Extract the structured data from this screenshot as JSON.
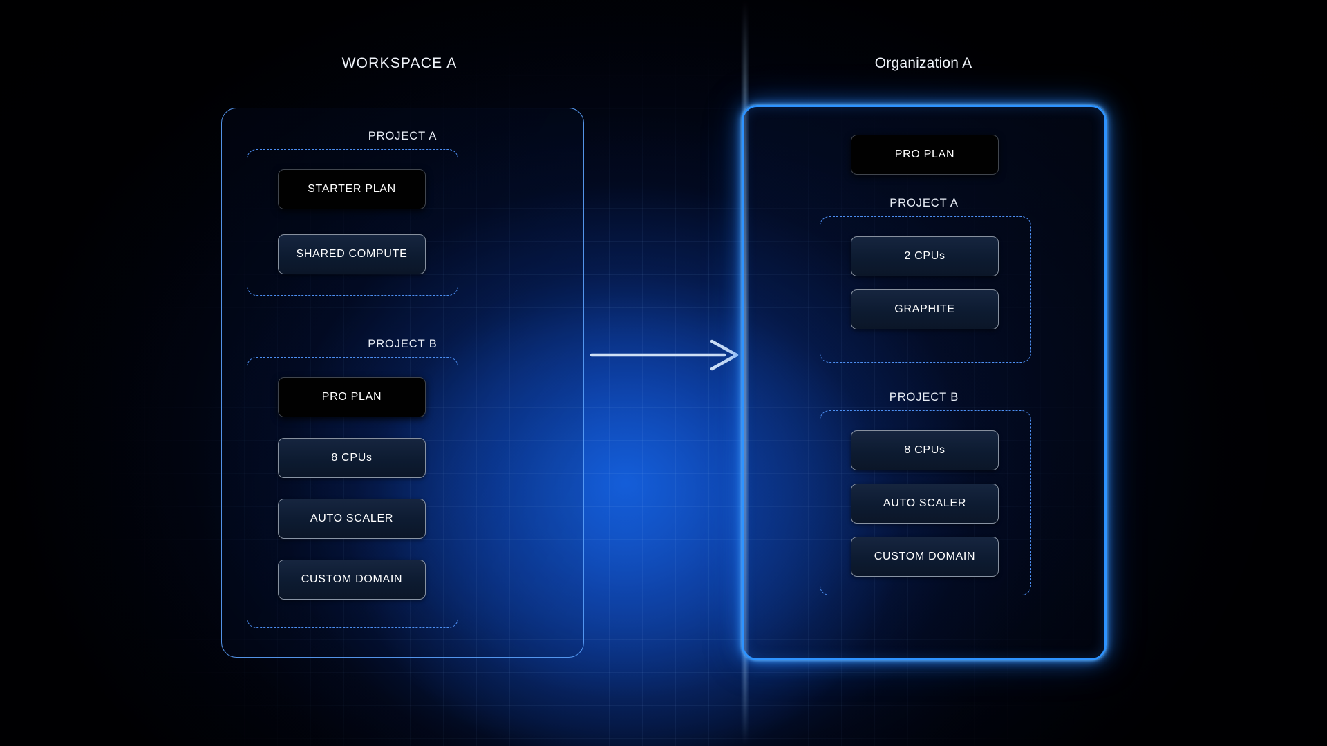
{
  "diagram": {
    "left_panel": {
      "title": "WORKSPACE A",
      "projects": [
        {
          "label": "PROJECT A",
          "items": [
            {
              "label": "STARTER PLAN",
              "style": "dark"
            },
            {
              "label": "SHARED COMPUTE",
              "style": "plain"
            }
          ]
        },
        {
          "label": "PROJECT B",
          "items": [
            {
              "label": "PRO PLAN",
              "style": "dark"
            },
            {
              "label": "8 CPUs",
              "style": "plain"
            },
            {
              "label": "AUTO SCALER",
              "style": "plain"
            },
            {
              "label": "CUSTOM DOMAIN",
              "style": "plain"
            }
          ]
        }
      ]
    },
    "right_panel": {
      "title": "Organization A",
      "plan": {
        "label": "PRO PLAN",
        "style": "dark"
      },
      "projects": [
        {
          "label": "PROJECT A",
          "items": [
            {
              "label": "2 CPUs",
              "style": "plain"
            },
            {
              "label": "GRAPHITE",
              "style": "plain"
            }
          ]
        },
        {
          "label": "PROJECT B",
          "items": [
            {
              "label": "8 CPUs",
              "style": "plain"
            },
            {
              "label": "AUTO SCALER",
              "style": "plain"
            },
            {
              "label": "CUSTOM DOMAIN",
              "style": "plain"
            }
          ]
        }
      ]
    },
    "arrow": {
      "name": "migration-arrow",
      "direction": "right"
    },
    "colors": {
      "background": "#000004",
      "glow_blue": "#1a6adc",
      "panel_border_left": "#5aa0fa",
      "panel_border_right": "#2e93ff",
      "dashed_border": "#4d8ff2",
      "card_fill": "#0d1b31",
      "card_dark_fill": "#010101",
      "card_border": "#aab4c0",
      "text": "#ffffff",
      "arrow": "#cfe0f5"
    }
  }
}
